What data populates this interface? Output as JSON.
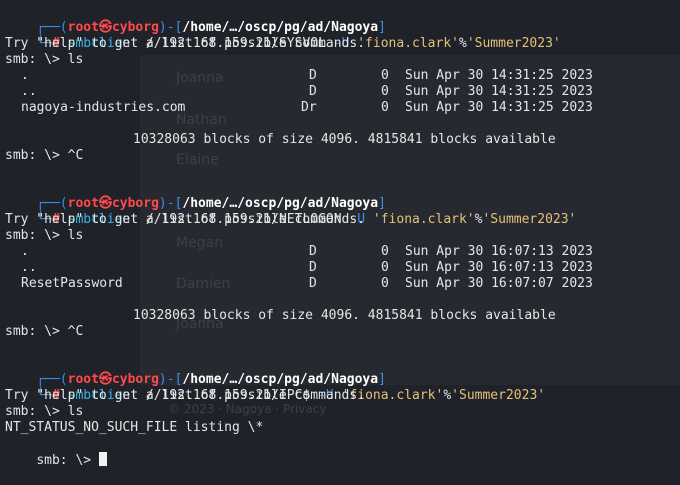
{
  "ghost": {
    "names": [
      "Joanna",
      "Nathan",
      "Elaine",
      "Megan",
      "Damien",
      "Joanna"
    ],
    "footer": "© 2023 · Nagoya · Privacy"
  },
  "blocks": [
    {
      "prompt": {
        "user": "root",
        "host": "cyborg",
        "path": "/home/…/oscp/pg/ad/Nagoya"
      },
      "command": {
        "prog": "smbclient",
        "target": "//192.168.159.21/SYSVOL",
        "flag": "-U",
        "user": "'fiona.clark'",
        "pct": "%",
        "pass": "'Summer2023'"
      },
      "help": "Try \"help\" to get a list of possible commands.",
      "prompt2": "smb: \\> ls",
      "entries": [
        {
          "name": ".",
          "attr": "D",
          "size": "0",
          "date": "Sun Apr 30 14:31:25 2023"
        },
        {
          "name": "..",
          "attr": "D",
          "size": "0",
          "date": "Sun Apr 30 14:31:25 2023"
        },
        {
          "name": "nagoya-industries.com",
          "attr": "Dr",
          "size": "0",
          "date": "Sun Apr 30 14:31:25 2023"
        }
      ],
      "blocks_info": "10328063 blocks of size 4096. 4815841 blocks available",
      "exit": "smb: \\> ^C"
    },
    {
      "prompt": {
        "user": "root",
        "host": "cyborg",
        "path": "/home/…/oscp/pg/ad/Nagoya"
      },
      "command": {
        "prog": "smbclient",
        "target": "//192.168.159.21/NETLOGON",
        "flag": "-U",
        "user": "'fiona.clark'",
        "pct": "%",
        "pass": "'Summer2023'"
      },
      "help": "Try \"help\" to get a list of possible commands.",
      "prompt2": "smb: \\> ls",
      "entries": [
        {
          "name": ".",
          "attr": "D",
          "size": "0",
          "date": "Sun Apr 30 16:07:13 2023"
        },
        {
          "name": "..",
          "attr": "D",
          "size": "0",
          "date": "Sun Apr 30 16:07:13 2023"
        },
        {
          "name": "ResetPassword",
          "attr": "D",
          "size": "0",
          "date": "Sun Apr 30 16:07:07 2023"
        }
      ],
      "blocks_info": "10328063 blocks of size 4096. 4815841 blocks available",
      "exit": "smb: \\> ^C"
    },
    {
      "prompt": {
        "user": "root",
        "host": "cyborg",
        "path": "/home/…/oscp/pg/ad/Nagoya"
      },
      "command": {
        "prog": "smbclient",
        "target": "//192.168.159.21/IPC$",
        "flag": "-U",
        "user": "'fiona.clark'",
        "pct": "%",
        "pass": "'Summer2023'"
      },
      "help": "Try \"help\" to get a list of possible commands.",
      "prompt2": "smb: \\> ls",
      "error": "NT_STATUS_NO_SUCH_FILE listing \\*",
      "final_prompt": "smb: \\>"
    }
  ],
  "prompt_symbols": {
    "top": "┌──(",
    "skull": "㉿",
    "close": ")-[",
    "end": "]",
    "bottom": "└─",
    "hash": "#"
  }
}
